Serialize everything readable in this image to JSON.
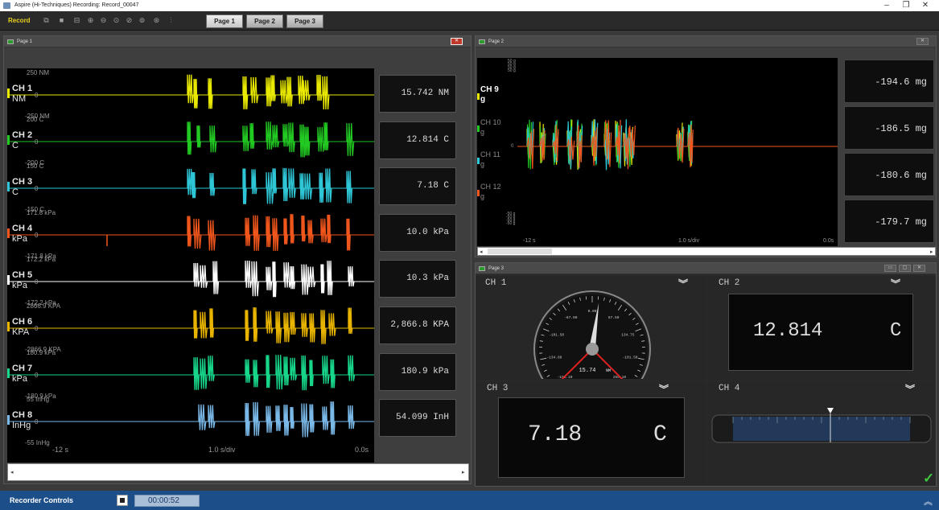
{
  "window": {
    "title": "Aspire (Hi-Techniques)    Recording: Record_00047"
  },
  "toolbar": {
    "record_label": "Record",
    "pages": [
      "Page 1",
      "Page 2",
      "Page 3"
    ],
    "icons": [
      "copy-icon",
      "save-icon",
      "export-icon",
      "zoom-in-icon",
      "zoom-out-icon",
      "zoom-fit-icon",
      "zoom-x-icon",
      "zoom-y-icon",
      "zoom-reset-icon",
      "cursor-icon"
    ]
  },
  "page1": {
    "title": "Page 1",
    "channels": [
      {
        "name": "CH 1",
        "unit": "NM",
        "top": "250 NM",
        "bottom": "-250 NM",
        "value": "15.742  NM",
        "color": "#e8e800"
      },
      {
        "name": "CH 2",
        "unit": "C",
        "top": "200 C",
        "bottom": "-200 C",
        "value": "12.814   C",
        "color": "#22c922"
      },
      {
        "name": "CH 3",
        "unit": "C",
        "top": "150 C",
        "bottom": "-150 C",
        "value": "7.18   C",
        "color": "#2ec6d6"
      },
      {
        "name": "CH 4",
        "unit": "kPa",
        "top": "171.8 kPa",
        "bottom": "-171.8 kPa",
        "value": "10.0 kPa",
        "color": "#f0561c"
      },
      {
        "name": "CH 5",
        "unit": "kPa",
        "top": "172.2 kPa",
        "bottom": "-172.2 kPa",
        "value": "10.3 kPa",
        "color": "#ffffff"
      },
      {
        "name": "CH 6",
        "unit": "KPA",
        "top": "2866.9 KPA",
        "bottom": "-2866.9 KPA",
        "value": "2,866.8 KPA",
        "color": "#e8b400"
      },
      {
        "name": "CH 7",
        "unit": "kPa",
        "top": "180.9 kPa",
        "bottom": "-180.9 kPa",
        "value": "180.9 kPa",
        "color": "#17d68a"
      },
      {
        "name": "CH 8",
        "unit": "InHg",
        "top": "55 InHg",
        "bottom": "-55 InHg",
        "value": "54.099 InH",
        "color": "#7ab8e8"
      }
    ],
    "zero": "0",
    "x_start": "-12 s",
    "x_div": "1.0 s/div",
    "x_end": "0.0s"
  },
  "page2": {
    "title": "Page 2",
    "channels": [
      {
        "name": "CH 9",
        "unit": "g",
        "value": "-194.6  mg",
        "color": "#e8e800"
      },
      {
        "name": "CH 10",
        "unit": "g",
        "value": "-186.5  mg",
        "color": "#22c922"
      },
      {
        "name": "CH 11",
        "unit": "g",
        "value": "-180.6  mg",
        "color": "#2ec6d6"
      },
      {
        "name": "CH 12",
        "unit": "g",
        "value": "-179.7  mg",
        "color": "#f0561c"
      }
    ],
    "ytop": [
      "50 g",
      "50 g",
      "50 g",
      "50 g"
    ],
    "ybot": [
      "-50 g",
      "-50 g",
      "-50 g",
      "-50 g"
    ],
    "zero": "0",
    "x_start": "-12 s",
    "x_div": "1.0 s/div",
    "x_end": "0.0s"
  },
  "page3": {
    "title": "Page 3",
    "ch1": {
      "label": "CH 1",
      "reading": "15.74",
      "unit": "NM",
      "ticks": [
        "-250.00",
        "-187.50",
        "-125.00",
        "-62.50",
        "0.00",
        "62.50",
        "125.00",
        "187.50",
        "250.00"
      ],
      "ticks_shown": [
        "-193.10",
        "-134.89",
        "-101.50",
        "-67.00",
        "0.00",
        "67.50",
        "134.75",
        "-101.50",
        "250.10"
      ],
      "fraction": 0.53
    },
    "ch2": {
      "label": "CH 2",
      "value": "12.814",
      "unit": "C"
    },
    "ch3": {
      "label": "CH 3",
      "value": "7.18",
      "unit": "C"
    },
    "ch4": {
      "label": "CH 4",
      "fraction": 0.55
    }
  },
  "status": {
    "label": "Recorder Controls",
    "timer": "00:00:52"
  }
}
